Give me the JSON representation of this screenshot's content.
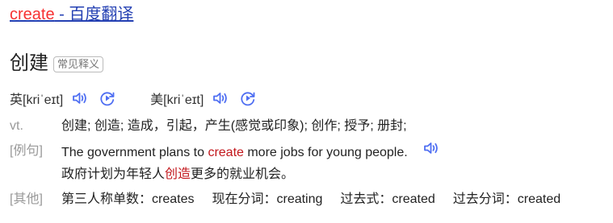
{
  "title": {
    "word": "create",
    "rest": " - 百度翻译"
  },
  "headword": {
    "text": "创建",
    "badge": "常见释义"
  },
  "pronunciations": [
    {
      "label": "英[kriˈeɪt]"
    },
    {
      "label": "美[kriˈeɪt]"
    }
  ],
  "definition": {
    "pos": "vt.",
    "meanings": "创建; 创造; 造成，引起，产生(感觉或印象); 创作; 授予; 册封;"
  },
  "example": {
    "label": "[例句]",
    "en_before": "The government plans to ",
    "en_highlight": "create",
    "en_after": " more jobs for young people.",
    "cn_before": "政府计划为年轻人",
    "cn_highlight": "创造",
    "cn_after": "更多的就业机会。"
  },
  "other": {
    "label": "[其他]",
    "forms": [
      "第三人称单数：creates",
      "现在分词：creating",
      "过去式：created",
      "过去分词：created"
    ]
  },
  "colors": {
    "link": "#2440b3",
    "highlight": "#f73131",
    "example_highlight": "#c2161b",
    "icon": "#4e6ef2",
    "label": "#999999"
  },
  "icons": {
    "speaker": "speaker-icon",
    "replay": "replay-icon"
  }
}
